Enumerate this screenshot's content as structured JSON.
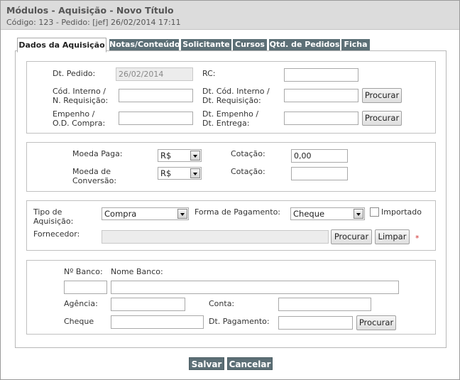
{
  "header": {
    "title": "Módulos - Aquisição - Novo Título",
    "subtitle": "Código: 123 - Pedido: [jef] 26/02/2014 17:11"
  },
  "tabs": [
    {
      "label": "Dados da Aquisição",
      "active": true
    },
    {
      "label": "Notas/Conteúdo",
      "active": false
    },
    {
      "label": "Solicitante",
      "active": false
    },
    {
      "label": "Cursos",
      "active": false
    },
    {
      "label": "Qtd. de Pedidos",
      "active": false
    },
    {
      "label": "Ficha",
      "active": false
    }
  ],
  "section1": {
    "dt_pedido_label": "Dt. Pedido:",
    "dt_pedido_value": "26/02/2014",
    "rc_label": "RC:",
    "rc_value": "",
    "cod_interno_label_1": "Cód. Interno /",
    "cod_interno_label_2": "N. Requisição:",
    "cod_interno_value": "",
    "dt_cod_interno_label_1": "Dt. Cód. Interno /",
    "dt_cod_interno_label_2": "Dt. Requisição:",
    "dt_cod_interno_value": "",
    "empenho_label_1": "Empenho /",
    "empenho_label_2": "O.D. Compra:",
    "empenho_value": "",
    "dt_empenho_label_1": "Dt. Empenho /",
    "dt_empenho_label_2": "Dt. Entrega:",
    "dt_empenho_value": "",
    "procurar_label": "Procurar"
  },
  "section2": {
    "moeda_paga_label": "Moeda Paga:",
    "moeda_paga_value": "R$",
    "cotacao1_label": "Cotação:",
    "cotacao1_value": "0,00",
    "moeda_conv_label_1": "Moeda de",
    "moeda_conv_label_2": "Conversão:",
    "moeda_conv_value": "R$",
    "cotacao2_label": "Cotação:",
    "cotacao2_value": ""
  },
  "section3": {
    "tipo_label_1": "Tipo de",
    "tipo_label_2": "Aquisição:",
    "tipo_value": "Compra",
    "forma_label": "Forma de Pagamento:",
    "forma_value": "Cheque",
    "importado_label": "Importado",
    "importado_checked": false,
    "fornecedor_label": "Fornecedor:",
    "fornecedor_value": "",
    "procurar_label": "Procurar",
    "limpar_label": "Limpar",
    "required_mark": "*"
  },
  "section4": {
    "n_banco_label": "Nº Banco:",
    "nome_banco_label": "Nome Banco:",
    "n_banco_value": "",
    "nome_banco_value": "",
    "agencia_label": "Agência:",
    "agencia_value": "",
    "conta_label": "Conta:",
    "conta_value": "",
    "cheque_label": "Cheque",
    "cheque_value": "",
    "dt_pagamento_label": "Dt. Pagamento:",
    "dt_pagamento_value": "",
    "procurar_label": "Procurar"
  },
  "actions": {
    "salvar_label": "Salvar",
    "cancelar_label": "Cancelar"
  },
  "colors": {
    "tab_bg": "#5c6f76",
    "header_bg": "#dcdcdc",
    "required": "#d03030"
  }
}
